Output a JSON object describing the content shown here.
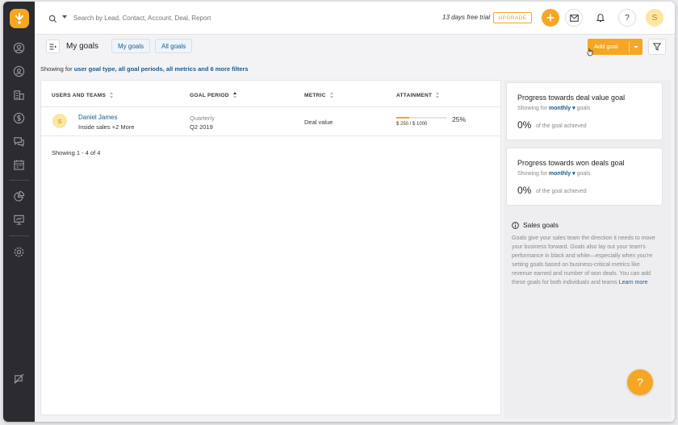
{
  "search": {
    "placeholder": "Search by Lead, Contact, Account, Deal, Report"
  },
  "topbar": {
    "trial_text": "13 days free trial",
    "upgrade_label": "UPGRADE",
    "avatar_initial": "S"
  },
  "subbar": {
    "page_title": "My goals",
    "tabs": [
      {
        "label": "My goals"
      },
      {
        "label": "All goals"
      }
    ],
    "add_goal_label": "Add goal"
  },
  "filters": {
    "prefix": "Showing for",
    "summary": "user goal type, all goal periods, all metrics and 6 more filters"
  },
  "table": {
    "columns": [
      {
        "label": "USERS AND TEAMS"
      },
      {
        "label": "GOAL PERIOD"
      },
      {
        "label": "METRIC"
      },
      {
        "label": "ATTAINMENT"
      }
    ],
    "rows": [
      {
        "avatar_initial": "S",
        "name": "Daniel James",
        "team": "Inside sales  +2 More",
        "period_type": "Quarterly",
        "period": "Q2 2019",
        "metric": "Deal value",
        "progress_fraction": 0.25,
        "progress_label": "$ 250 / $ 1000",
        "attainment": "25%"
      }
    ],
    "pagination": "Showing 1 - 4 of 4"
  },
  "cards": [
    {
      "title": "Progress towards deal value goal",
      "sub_prefix": "Showing for",
      "period": "monthly",
      "sub_suffix": "goals",
      "value": "0%",
      "value_note": "of the goal achieved"
    },
    {
      "title": "Progress towards won deals goal",
      "sub_prefix": "Showing for",
      "period": "monthly",
      "sub_suffix": "goals",
      "value": "0%",
      "value_note": "of the goal achieved"
    }
  ],
  "info": {
    "title": "Sales goals",
    "body": "Goals give your sales team the direction it needs to move your business forward. Goals also lay out your team's performance in black and white—especially when you're setting goals based on business-critical metrics like revenue earned and number of won deals. You can add these goals for both individuals and teams",
    "link": "Learn more"
  },
  "help_label": "?",
  "colors": {
    "accent": "#f5a623",
    "link": "#1d5a8c",
    "sidebar": "#2b2b30"
  },
  "icons": {
    "sidebar": [
      "user-circle-icon",
      "contacts-icon",
      "building-icon",
      "dollar-icon",
      "chat-icon",
      "calendar-icon",
      "pie-chart-icon",
      "presentation-icon",
      "gear-icon",
      "megaphone-icon"
    ],
    "top": [
      "search-icon",
      "plus-icon",
      "mail-icon",
      "bell-icon",
      "question-icon"
    ],
    "other": [
      "list-toggle-icon",
      "filter-icon",
      "info-icon",
      "cursor-icon"
    ]
  }
}
